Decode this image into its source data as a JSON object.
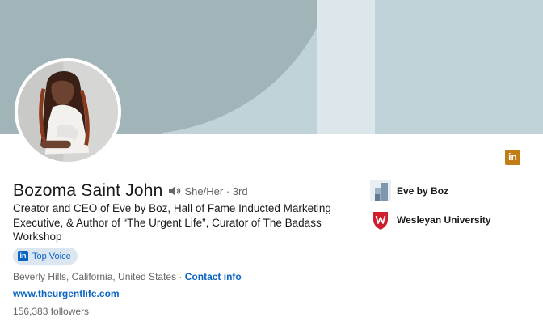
{
  "profile": {
    "name": "Bozoma Saint John",
    "pronouns": "She/Her",
    "degree": "· 3rd",
    "headline": "Creator and CEO of Eve by Boz, Hall of Fame Inducted Marketing Executive, & Author of “The Urgent Life”, Curator of The Badass Workshop",
    "badge": "Top Voice",
    "location": "Beverly Hills, California, United States",
    "separator": " · ",
    "contact_info": "Contact info",
    "website": "www.theurgentlife.com",
    "followers": "156,383 followers"
  },
  "experience": [
    {
      "label": "Eve by Boz",
      "icon": "company-logo-icon"
    },
    {
      "label": "Wesleyan University",
      "icon": "wesleyan-shield-icon"
    }
  ],
  "icons": {
    "linkedin_corner": "in",
    "badge_logo": "in",
    "speaker": "speaker-icon"
  },
  "colors": {
    "banner_dark": "#a1b5b9",
    "banner_light": "#c0d3d8",
    "banner_mid": "#dbe7ea",
    "link_blue": "#0a66c2",
    "badge_bg": "#dce6f1",
    "linkedin_gold": "#c37d16",
    "wesleyan_red": "#cf1f2e"
  }
}
